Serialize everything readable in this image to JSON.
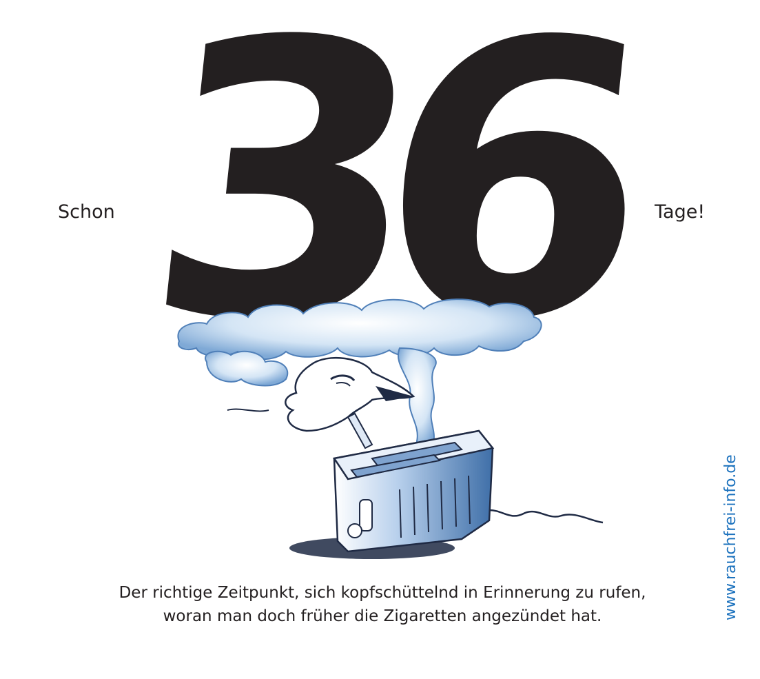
{
  "counter": {
    "prefix": "Schon",
    "number": "36",
    "suffix": "Tage!"
  },
  "caption": {
    "line1": "Der richtige Zeitpunkt, sich kopfschüttelnd in Erinnerung zu rufen,",
    "line2": "woran man doch früher die Zigaretten angezündet hat."
  },
  "website": "www.rauchfrei-info.de",
  "colors": {
    "text": "#231f20",
    "accent": "#1e73be",
    "smoke": "#a9c8e8",
    "toaster": "#8fb3dc"
  },
  "icons": [
    "smoke-cloud-icon",
    "person-head-icon",
    "toaster-icon",
    "power-cord-icon"
  ]
}
